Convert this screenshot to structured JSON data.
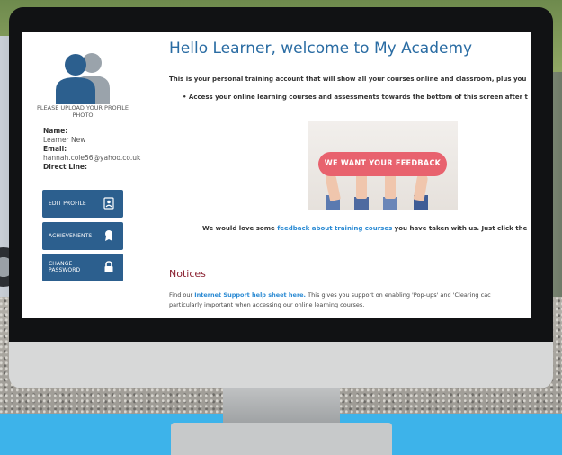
{
  "sidebar": {
    "upload_text": "PLEASE UPLOAD YOUR PROFILE PHOTO",
    "name_label": "Name:",
    "name_value": "Learner New",
    "email_label": "Email:",
    "email_value": "hannah.cole56@yahoo.co.uk",
    "direct_line_label": "Direct Line:",
    "buttons": [
      {
        "label": "EDIT PROFILE",
        "icon": "id-card-icon"
      },
      {
        "label": "ACHIEVEMENTS",
        "icon": "award-icon"
      },
      {
        "label_line1": "CHANGE",
        "label_line2": "PASSWORD",
        "icon": "lock-icon"
      }
    ]
  },
  "main": {
    "title": "Hello Learner, welcome to My Academy",
    "intro": "This is your personal training account that will show all your courses online and classroom, plus you",
    "bullet": "Access your online learning courses and assessments towards the bottom of this screen after t",
    "feedback_banner": "WE WANT YOUR FEEDBACK",
    "feedback_prefix": "We would love some ",
    "feedback_link": "feedback about training courses",
    "feedback_suffix": " you have taken with us.  Just click the",
    "notices_heading": "Notices",
    "support_prefix": "Find our ",
    "support_link": "Internet Support help sheet here.",
    "support_suffix": "  This gives you support on enabling 'Pop-ups' and 'Clearing cac",
    "support_line2": "particularly important when accessing our online learning courses."
  },
  "colors": {
    "accent_blue": "#2a6ca3",
    "button_blue": "#2c5f8e",
    "link_blue": "#2a8ad3",
    "notices_red": "#8a2030",
    "banner_pink": "#e8626e",
    "floor_blue": "#3db3ea"
  }
}
